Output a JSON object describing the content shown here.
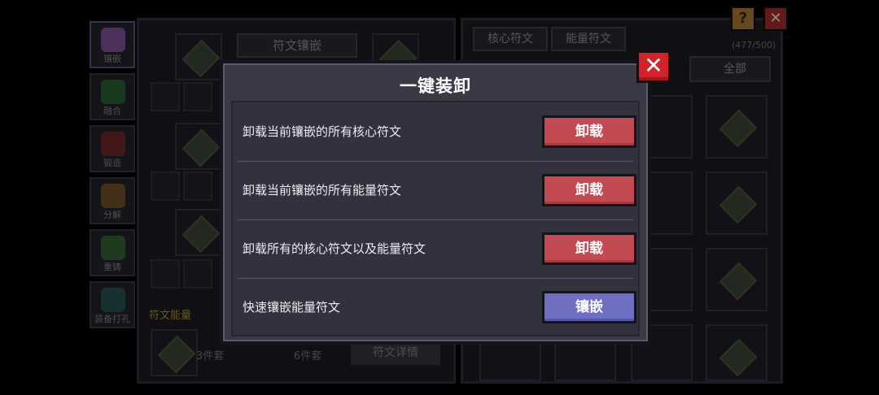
{
  "background": {
    "side_tabs": [
      "镶嵌",
      "融合",
      "锻造",
      "分解",
      "重铸",
      "装备打孔"
    ],
    "left_panel_title": "符文镶嵌",
    "rune_energy_label": "符文能量",
    "set_3": "3件套",
    "set_6": "6件套",
    "detail_button": "符文详情",
    "tabs": [
      "核心符文",
      "能量符文"
    ],
    "count": "(477/500)",
    "filter_all": "全部"
  },
  "top_buttons": {
    "help": "?",
    "close": "✕"
  },
  "modal": {
    "title": "一键装卸",
    "close": "✕",
    "rows": [
      {
        "label": "卸载当前镶嵌的所有核心符文",
        "button": "卸载",
        "style": "red"
      },
      {
        "label": "卸载当前镶嵌的所有能量符文",
        "button": "卸载",
        "style": "red"
      },
      {
        "label": "卸载所有的核心符文以及能量符文",
        "button": "卸载",
        "style": "red"
      },
      {
        "label": "快速镶嵌能量符文",
        "button": "镶嵌",
        "style": "blue"
      }
    ]
  },
  "colors": {
    "unload": "#c24a52",
    "embed": "#6f6fc2",
    "close": "#d0242a"
  }
}
